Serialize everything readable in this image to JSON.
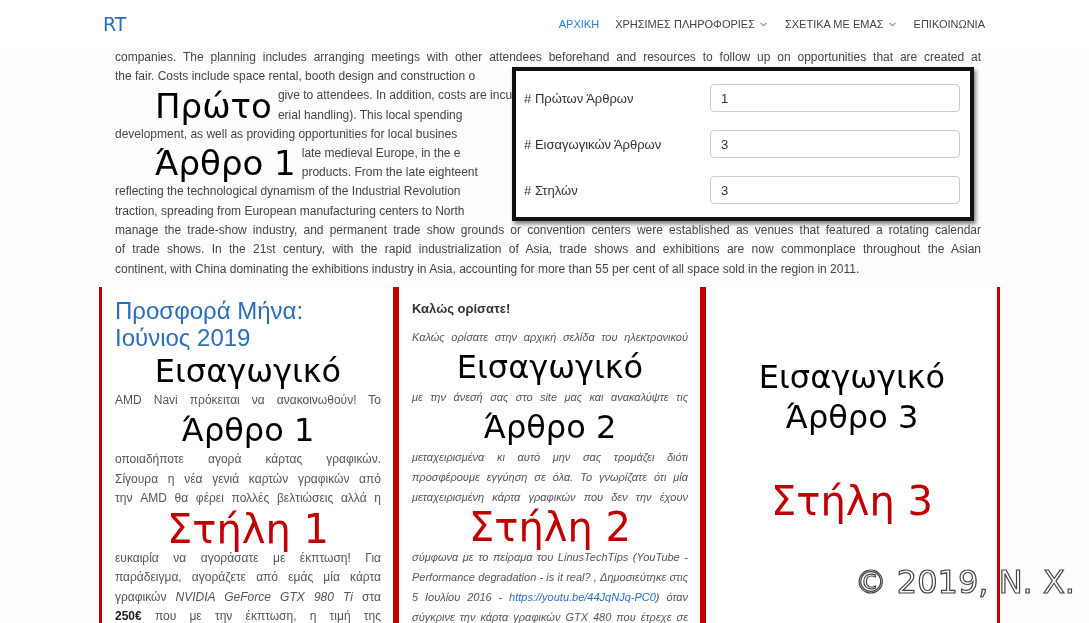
{
  "navbar": {
    "brand": "RT",
    "links": [
      {
        "label": "ΑΡΧΙΚΗ",
        "selected": true,
        "dropdown": false
      },
      {
        "label": "ΧΡΗΣΙΜΕΣ ΠΛΗΡΟΦΟΡΙΕΣ",
        "selected": false,
        "dropdown": true
      },
      {
        "label": "ΣΧΕΤΙΚΑ ΜΕ ΕΜΑΣ",
        "selected": false,
        "dropdown": true
      },
      {
        "label": "ΕΠΙΚΟΙΝΩΝΙΑ",
        "selected": false,
        "dropdown": false
      }
    ]
  },
  "intro": {
    "lines_top": [
      "companies. The planning includes arranging meetings with other attendees beforehand and resources to follow up on opportunities that are created at"
    ],
    "rows_beside_form": [
      {
        "kind": "text",
        "text": "the fair. Costs include space rental, booth design and construction o"
      },
      {
        "kind": "annotated",
        "annotation": "Πρώτο",
        "tails": [
          "give to attendees. In addition, costs are incu",
          "erial handling). This local spending"
        ]
      },
      {
        "kind": "text",
        "text": "development, as well as providing opportunities for local busines"
      },
      {
        "kind": "annotated",
        "annotation": "Άρθρο 1",
        "tails": [
          "late medieval Europe, in the e",
          "products. From the late eighteent"
        ]
      },
      {
        "kind": "text",
        "text": "reflecting the technological dynamism of the Industrial Revolution"
      },
      {
        "kind": "text",
        "text": "traction, spreading from European manufacturing centers to North"
      }
    ],
    "lines_bottom": [
      "manage the trade-show industry, and permanent trade show grounds or convention centers were established as venues that featured a rotating calendar",
      "of trade shows. In the 21st century, with the rapid industrialization of Asia, trade shows and exhibitions are now commonplace throughout the Asian",
      "continent, with China dominating the exhibitions industry in Asia, accounting for more than 55 per cent of all space sold in the region in 2011."
    ]
  },
  "settings_form": {
    "fields": [
      {
        "label": "# Πρώτων Άρθρων",
        "value": "1"
      },
      {
        "label": "# Εισαγωγικών Άρθρων",
        "value": "3"
      },
      {
        "label": "# Στηλών",
        "value": "3"
      }
    ]
  },
  "columns": [
    {
      "kind": "headline",
      "heading": "Προσφορά Μήνα: Ιούνιος 2019",
      "rows": [
        {
          "kind": "annotation",
          "text": "Εισαγωγικό"
        },
        {
          "kind": "line",
          "text": "AMD Navi πρόκειται να ανακοινωθούν! Το"
        },
        {
          "kind": "annotation",
          "text": "Άρθρο 1"
        },
        {
          "kind": "line",
          "text": "οποιαδήποτε αγορά κάρτας γραφικών."
        },
        {
          "kind": "line",
          "text": "Σίγουρα η νέα γενιά καρτών γραφικών από"
        },
        {
          "kind": "line",
          "text": "την AMD θα φέρει πολλές βελτιώσεις αλλά η"
        },
        {
          "kind": "column_label",
          "text": "Στήλη 1"
        },
        {
          "kind": "line",
          "text": "ευκαιρία να αγοράσατε με έκπτωση! Για"
        },
        {
          "kind": "line",
          "text": "παράδειγμα, αγοράζετε από εμάς μία κάρτα"
        },
        {
          "kind": "line",
          "text": "γραφικών *NVIDIA GeForce GTX 980 Ti* στα"
        },
        {
          "kind": "line",
          "text": "**250€** που με την έκπτωση, η τιμή της"
        }
      ]
    },
    {
      "kind": "welcome",
      "heading": "Καλώς ορίσατε!",
      "rows": [
        {
          "kind": "line",
          "text": "Καλώς ορίσατε στην αρχική σελίδα του ηλεκτρονικού"
        },
        {
          "kind": "annotation",
          "text": "Εισαγωγικό"
        },
        {
          "kind": "line",
          "text": "με την άνεσή σας στο site μας και ανακαλύψτε τις"
        },
        {
          "kind": "annotation",
          "text": "Άρθρο 2"
        },
        {
          "kind": "line",
          "text": "μεταχειρισμένα κι αυτό μην σας τρομάζει διότι"
        },
        {
          "kind": "line",
          "text": "προσφέρουμε εγγύηση σε όλα. Το γνωρίζατε ότι μία"
        },
        {
          "kind": "line",
          "text": "μεταχειρισμένη κάρτα γραφικών που δεν την έχουν"
        },
        {
          "kind": "column_label",
          "text": "Στήλη 2"
        },
        {
          "kind": "line",
          "text": "σύμφωνα με το πείραμα του LinusTechTips (YouTube -"
        },
        {
          "kind": "line",
          "text": "Performance degradation - is it real? , Δημοσιεύτηκε στις"
        },
        {
          "kind": "line",
          "text": "5 Ιουλίου 2016 - ",
          "link": "https://youtu.be/44JqNJq-PC0",
          "after": ") όταν"
        },
        {
          "kind": "line",
          "text": "σύγκρινε την κάρτα γραφικών GTX 480 που έτρεχε σε"
        }
      ]
    },
    {
      "kind": "blank",
      "rows": [
        {
          "kind": "annotation",
          "text": "Εισαγωγικό"
        },
        {
          "kind": "annotation",
          "text": "Άρθρο 3"
        },
        {
          "kind": "column_label",
          "text": "Στήλη 3"
        }
      ]
    }
  ],
  "copyright": "© 2019, N. X."
}
